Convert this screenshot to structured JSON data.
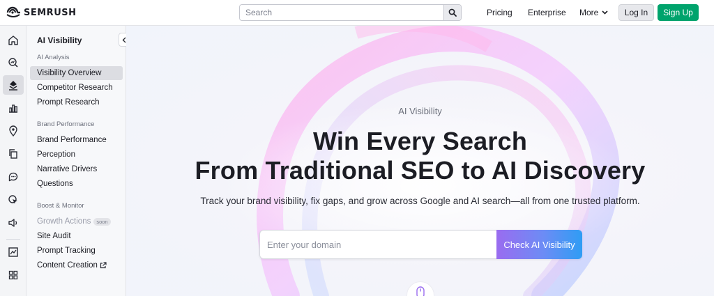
{
  "header": {
    "logo_text": "SEMRUSH",
    "search_placeholder": "Search",
    "nav": {
      "pricing": "Pricing",
      "enterprise": "Enterprise",
      "more": "More"
    },
    "login_label": "Log In",
    "signup_label": "Sign Up"
  },
  "rail": {
    "icons": [
      "home-icon",
      "search-chart-icon",
      "ai-visibility-icon",
      "bar-chart-icon",
      "location-pin-icon",
      "copy-icon",
      "chat-bubble-icon",
      "cursor-target-icon",
      "speaker-icon",
      "line-chart-icon",
      "grid-icon"
    ],
    "active_index": 2
  },
  "sidebar": {
    "title": "AI Visibility",
    "sections": {
      "analysis": {
        "label": "AI Analysis",
        "items": [
          "Visibility Overview",
          "Competitor Research",
          "Prompt Research"
        ]
      },
      "brand": {
        "label": "Brand Performance",
        "items": [
          "Brand Performance",
          "Perception",
          "Narrative Drivers",
          "Questions"
        ]
      },
      "boost": {
        "label": "Boost & Monitor",
        "items": [
          "Growth Actions",
          "Site Audit",
          "Prompt Tracking",
          "Content Creation"
        ],
        "soon_badge": "soon"
      }
    }
  },
  "hero": {
    "eyebrow": "AI Visibility",
    "headline_line1": "Win Every Search",
    "headline_line2": "From Traditional SEO to AI Discovery",
    "subline": "Track your brand visibility, fix gaps, and grow across Google and AI search—all from one trusted platform.",
    "domain_placeholder": "Enter your domain",
    "cta_label": "Check AI Visibility"
  },
  "colors": {
    "brand_green": "#00a36c",
    "cta_gradient_start": "#9a6cf0",
    "cta_gradient_end": "#2f9df4",
    "active_item": "#dcdde2"
  }
}
